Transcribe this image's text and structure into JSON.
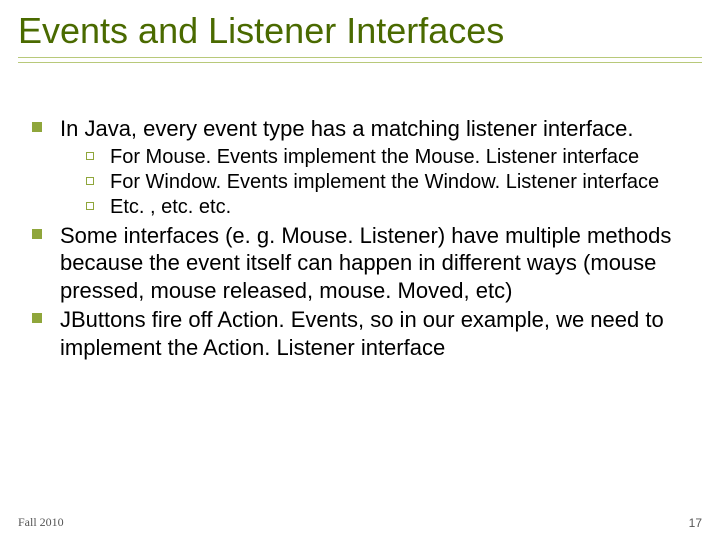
{
  "slide": {
    "title": "Events and Listener Interfaces",
    "bullets": [
      {
        "text": "In Java, every event type has a matching listener interface.",
        "sub": [
          "For Mouse. Events implement the Mouse. Listener interface",
          "For Window. Events implement the Window. Listener interface",
          "Etc. , etc. etc."
        ]
      },
      {
        "text": "Some interfaces (e. g. Mouse. Listener) have multiple methods because the event itself can happen in different ways (mouse pressed, mouse released, mouse. Moved, etc)",
        "sub": []
      },
      {
        "text": "JButtons fire off Action. Events, so in our example, we need to implement the Action. Listener interface",
        "sub": []
      }
    ],
    "footer_left": "Fall 2010",
    "footer_right": "17"
  }
}
